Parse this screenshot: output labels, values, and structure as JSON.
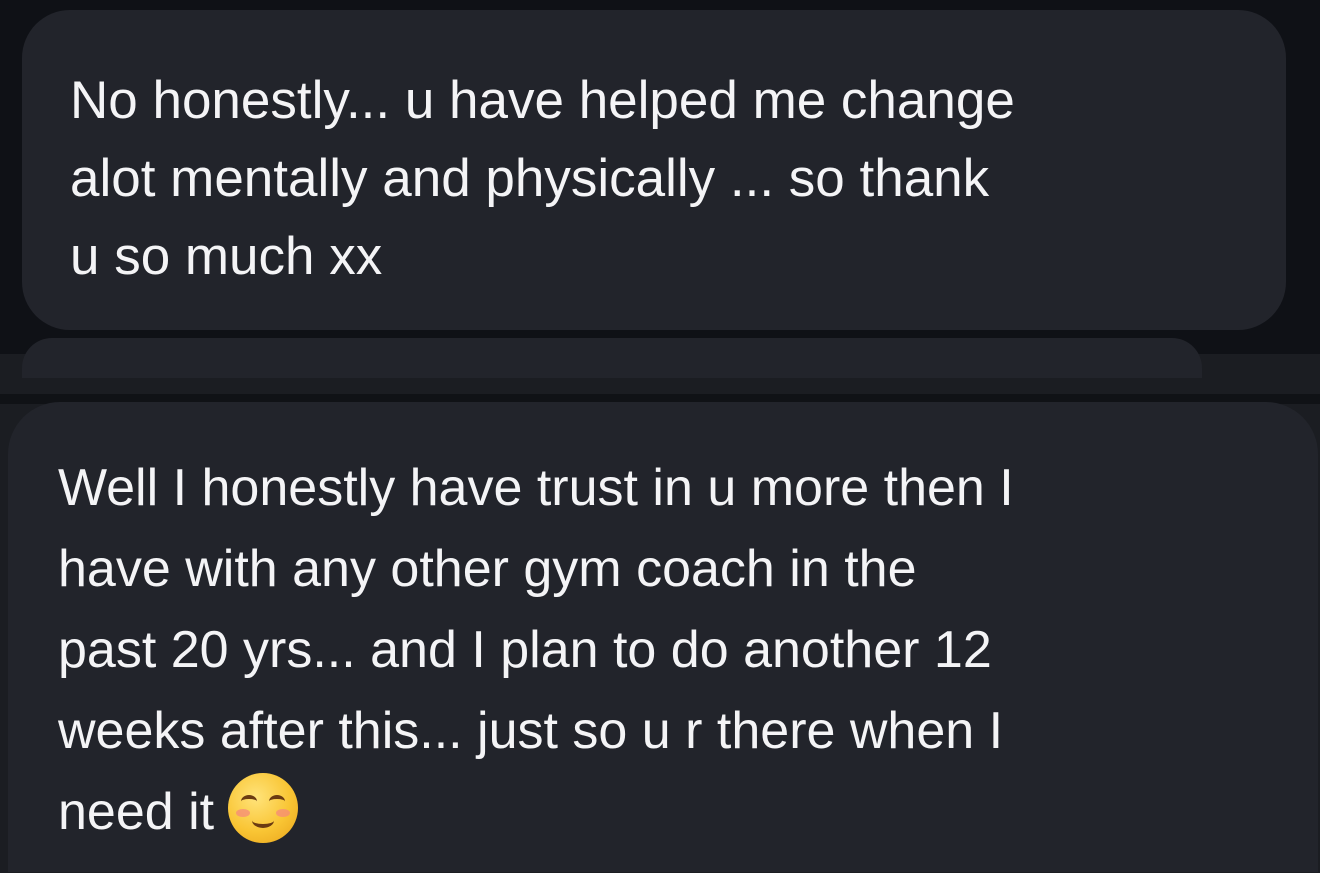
{
  "messages": [
    {
      "lines": [
        "No honestly... u have helped me change",
        "alot  mentally and physically ... so thank",
        "u so much xx"
      ]
    },
    {
      "lines": [
        "Well I honestly have trust in u more then I",
        "have with any other gym coach in the",
        "past 20 yrs... and I plan to do another 12",
        "weeks after this... just so u r there when I",
        "need it"
      ],
      "emoji": "smiling-face-with-smiling-eyes"
    }
  ],
  "colors": {
    "bubble": "#22242b",
    "text": "#f4f4f6",
    "background_top": "#0f1116",
    "background_bottom": "#1b1d22"
  }
}
